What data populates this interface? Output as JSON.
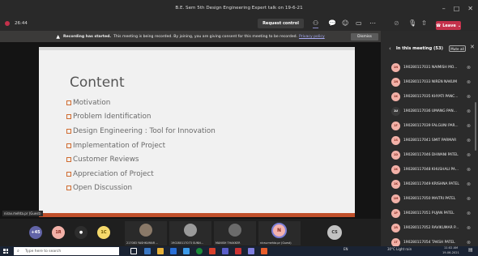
{
  "window": {
    "title": "B.E. Sem 5th Design Engineering Expert talk on 19-6-21"
  },
  "toolbar": {
    "timer": "26:44",
    "request_control": "Request control"
  },
  "controls": {
    "leave": "Leave"
  },
  "banner": {
    "bold": "Recording has started.",
    "text": "This meeting is being recorded. By joining, you are giving consent for this meeting to be recorded.",
    "link": "Privacy policy",
    "dismiss": "Dismiss"
  },
  "slide": {
    "title": "Content",
    "bullets": [
      "Motivation",
      "Problem Identification",
      "Design Engineering : Tool for Innovation",
      "Implementation of Project",
      "Customer Reviews",
      "Appreciation of Project",
      "Open Discussion"
    ]
  },
  "presenter_tag": "nirav.mehta.pr (Guest)",
  "thumbs": {
    "bubbles": [
      {
        "label": "+45",
        "color": "#6264a7"
      },
      {
        "label": "1R",
        "color": "#f2b1a8"
      },
      {
        "label": "1C",
        "color": "#f5d96b"
      }
    ],
    "tiles": [
      "217083 YASHKUMAR ...",
      "190280117073 SUNN...",
      "MANISH THAKKER",
      "nirav.mehta.pr (Guest)"
    ],
    "n_avatar": "N",
    "cs_avatar": "CS"
  },
  "panel": {
    "title": "In this meeting (53)",
    "mute_all": "Mute all",
    "participants": [
      {
        "initials": "1N",
        "name": "190280117031 NAIMISH MO..."
      },
      {
        "initials": "1N",
        "name": "190280117033 NIREN NAKUM"
      },
      {
        "initials": "1K",
        "name": "190280117035 KHYATI PANC..."
      },
      {
        "initials": "1U",
        "name": "190280117036 UMANG PAN..."
      },
      {
        "initials": "1F",
        "name": "190280117039 FALGUNI PAR..."
      },
      {
        "initials": "1S",
        "name": "190280117041 SMIT PARMAR"
      },
      {
        "initials": "1D",
        "name": "190280117046 DHWANI PATEL"
      },
      {
        "initials": "1K",
        "name": "190280117048 KHUSHALI PA..."
      },
      {
        "initials": "1K",
        "name": "190280117049 KRISHNA PATEL"
      },
      {
        "initials": "1M",
        "name": "190280117050 MAITRI PATEL"
      },
      {
        "initials": "1P",
        "name": "190280117051 PUJAN PATEL"
      },
      {
        "initials": "1R",
        "name": "190280117052 RAVIKUMAR P..."
      },
      {
        "initials": "1T",
        "name": "190280117054 TAKSH PATEL"
      }
    ]
  },
  "taskbar": {
    "search_placeholder": "Type here to search",
    "lang": "EN",
    "weather": "30°C Light rain",
    "time": "11:02 AM",
    "date": "19-06-2021"
  }
}
